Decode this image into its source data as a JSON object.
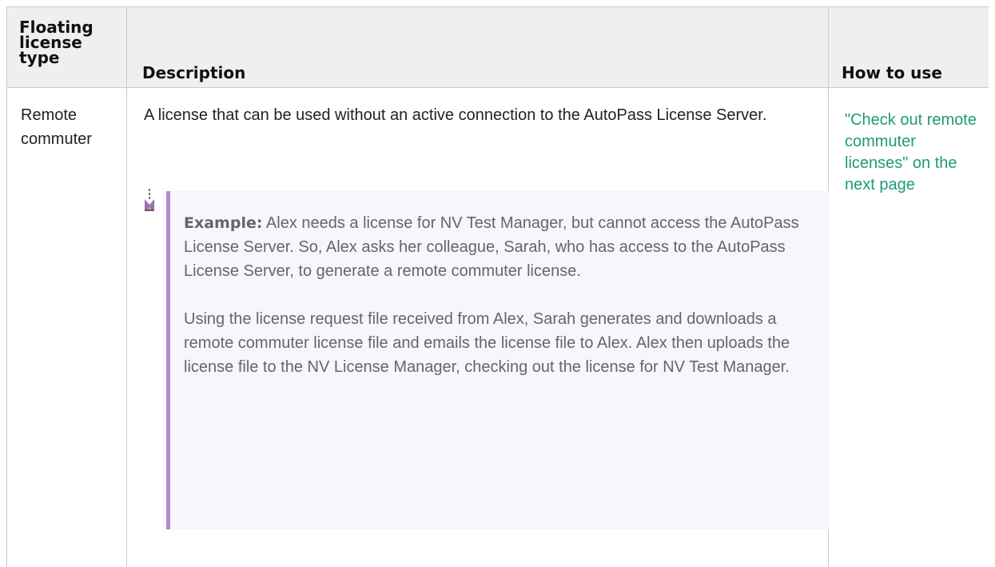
{
  "table": {
    "headers": {
      "type": "Floating license type",
      "description": "Description",
      "how_to_use": "How to use"
    },
    "rows": [
      {
        "type": "Remote commuter",
        "description": "A license that can be used without an active connection to the AutoPass License Server.",
        "example": {
          "label": "Example:",
          "paragraph1": "Alex needs a license for NV Test Manager, but cannot access the AutoPass License Server. So, Alex asks her colleague, Sarah, who has access to the AutoPass License Server, to generate a remote commuter license.",
          "paragraph2": "Using the license request file received from Alex, Sarah generates and downloads a remote commuter license file and emails the license file to Alex. Alex then uploads the license file to the NV License Manager, checking out the license for NV Test Manager."
        },
        "how_to_use": "\"Check out remote commuter licenses\" on the next page"
      }
    ]
  },
  "colors": {
    "header_background": "#efefef",
    "border": "#c9c9c9",
    "example_accent": "#b38acb",
    "example_background": "#f8f5fb",
    "link": "#1d9a7a"
  },
  "icons": {
    "example": "example-flag-icon"
  }
}
